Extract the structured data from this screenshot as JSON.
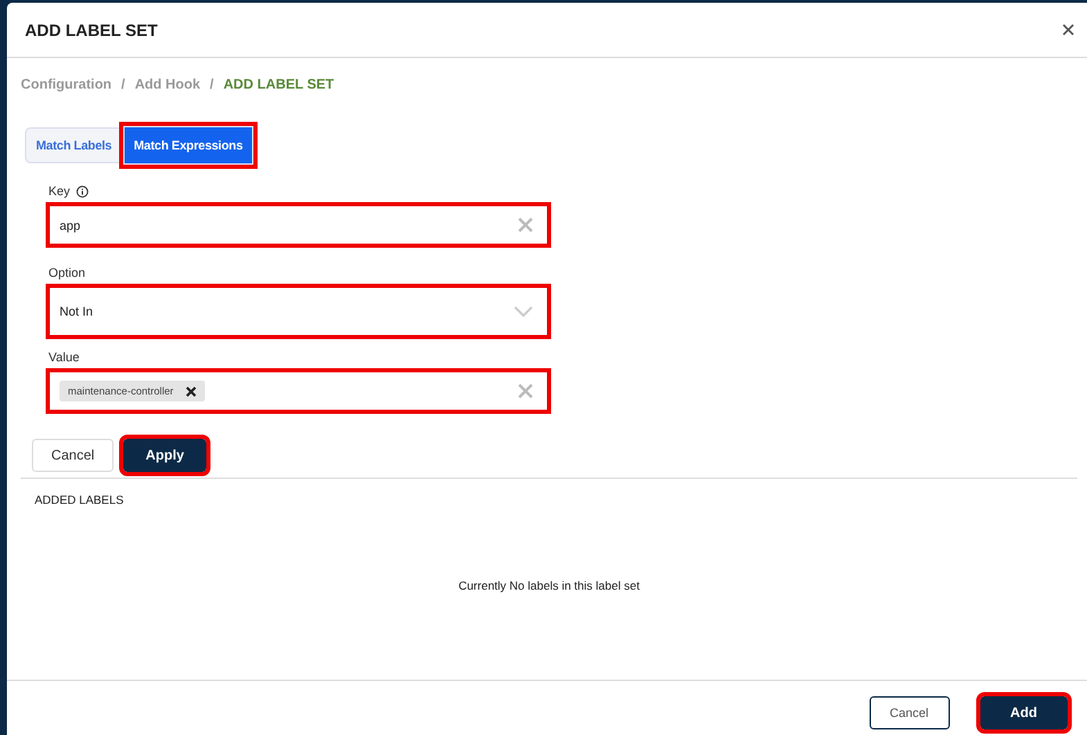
{
  "dialog": {
    "title": "ADD LABEL SET"
  },
  "breadcrumb_separator": "/",
  "breadcrumb": [
    {
      "label": "Configuration",
      "current": false
    },
    {
      "label": "Add Hook",
      "current": false
    },
    {
      "label": "ADD LABEL SET",
      "current": true
    }
  ],
  "tabs": [
    {
      "label": "Match Labels",
      "selected": false
    },
    {
      "label": "Match Expressions",
      "selected": true
    }
  ],
  "key_field": {
    "label": "Key",
    "value": "app"
  },
  "option_field": {
    "label": "Option",
    "value": "Not In"
  },
  "value_field": {
    "label": "Value",
    "chips": [
      "maintenance-controller"
    ]
  },
  "form_buttons": {
    "cancel": "Cancel",
    "apply": "Apply"
  },
  "added_labels": {
    "heading": "ADDED LABELS",
    "empty_message": "Currently No labels in this label set"
  },
  "footer": {
    "cancel": "Cancel",
    "add": "Add"
  }
}
